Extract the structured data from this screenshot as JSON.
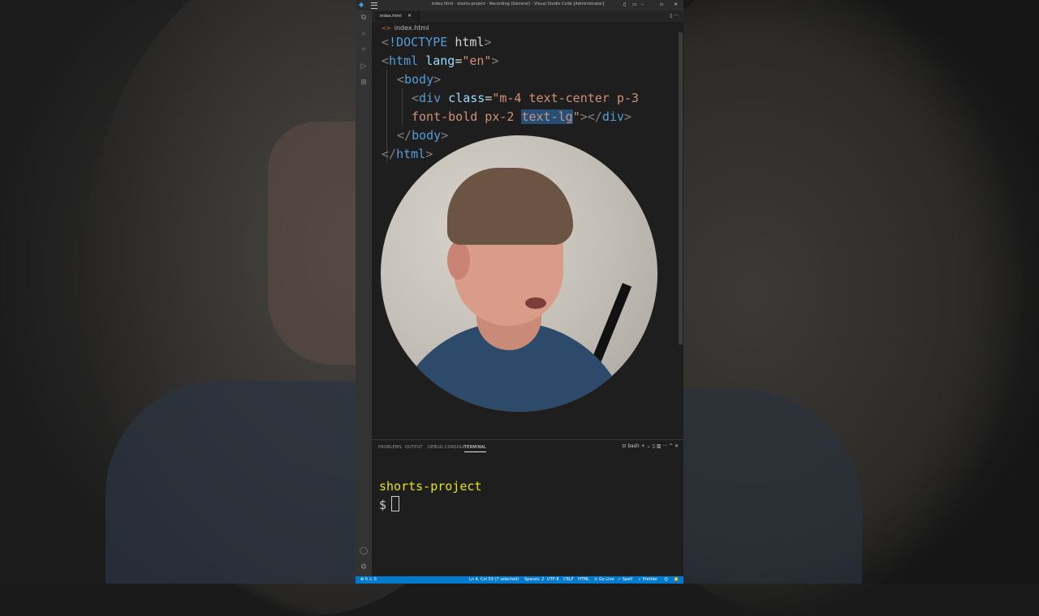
{
  "window": {
    "title": "index.html - shorts-project - Recording (General) - Visual Studio Code [Administrator]",
    "controls": {
      "minimize": "–",
      "maximize": "▫",
      "close": "✕"
    },
    "layout_icons": [
      "▯",
      "▭",
      "▯",
      "▥"
    ]
  },
  "activity_bar": {
    "items": [
      {
        "name": "explorer-icon",
        "glyph": "⧉"
      },
      {
        "name": "search-icon",
        "glyph": "⌕"
      },
      {
        "name": "source-control-icon",
        "glyph": "⑂"
      },
      {
        "name": "run-debug-icon",
        "glyph": "▷"
      },
      {
        "name": "extensions-icon",
        "glyph": "⊞"
      }
    ],
    "bottom": [
      {
        "name": "account-icon",
        "glyph": "◯"
      },
      {
        "name": "manage-gear-icon",
        "glyph": "⚙"
      }
    ]
  },
  "tabs": [
    {
      "label": "index.html",
      "close": "✕"
    }
  ],
  "tab_actions": "▯ ···",
  "breadcrumb": {
    "icon": "<>",
    "label": "index.html"
  },
  "code": {
    "line1": {
      "open": "<",
      "bang": "!DOCTYPE",
      "tag": "html",
      "close": ">"
    },
    "line2": {
      "open": "<",
      "tag": "html",
      "attr": "lang",
      "eq": "=",
      "val": "\"en\"",
      "close": ">"
    },
    "line3": {
      "open": "<",
      "tag": "body",
      "close": ">"
    },
    "line4": {
      "open": "<",
      "tag": "div",
      "attr": "class",
      "eq": "=",
      "val": "\"m-4 text-center p-3"
    },
    "line5": {
      "val": "font-bold px-2 ",
      "sel": "text-lg",
      "valend": "\"",
      "close": "></",
      "tag": "div",
      "close2": ">"
    },
    "line6": {
      "open": "</",
      "tag": "body",
      "close": ">"
    },
    "line7": {
      "open": "</",
      "tag": "html",
      "close": ">"
    }
  },
  "panel": {
    "tabs": [
      "PROBLEMS",
      "OUTPUT",
      "DEBUG CONSOLE",
      "TERMINAL"
    ],
    "active_tab": "TERMINAL",
    "actions": {
      "shell": "bash",
      "add": "+",
      "split": "▯",
      "trash": "🗑",
      "maximize": "^",
      "close": "✕"
    },
    "terminal": {
      "cwd": "shorts-project",
      "prompt": "$"
    }
  },
  "status_bar": {
    "problems": "⊗ 0  ⚠ 0",
    "position": "Ln 4, Col 59 (7 selected)",
    "spaces": "Spaces: 2",
    "encoding": "UTF-8",
    "eol": "CRLF",
    "language": "HTML",
    "golive": "Go Live",
    "spell": "Spell",
    "prettier": "Prettier"
  },
  "colors": {
    "editor_bg": "#1e1e1e",
    "status_bar": "#007acc",
    "selection": "#264f78",
    "terminal_cwd": "#e5e510"
  }
}
